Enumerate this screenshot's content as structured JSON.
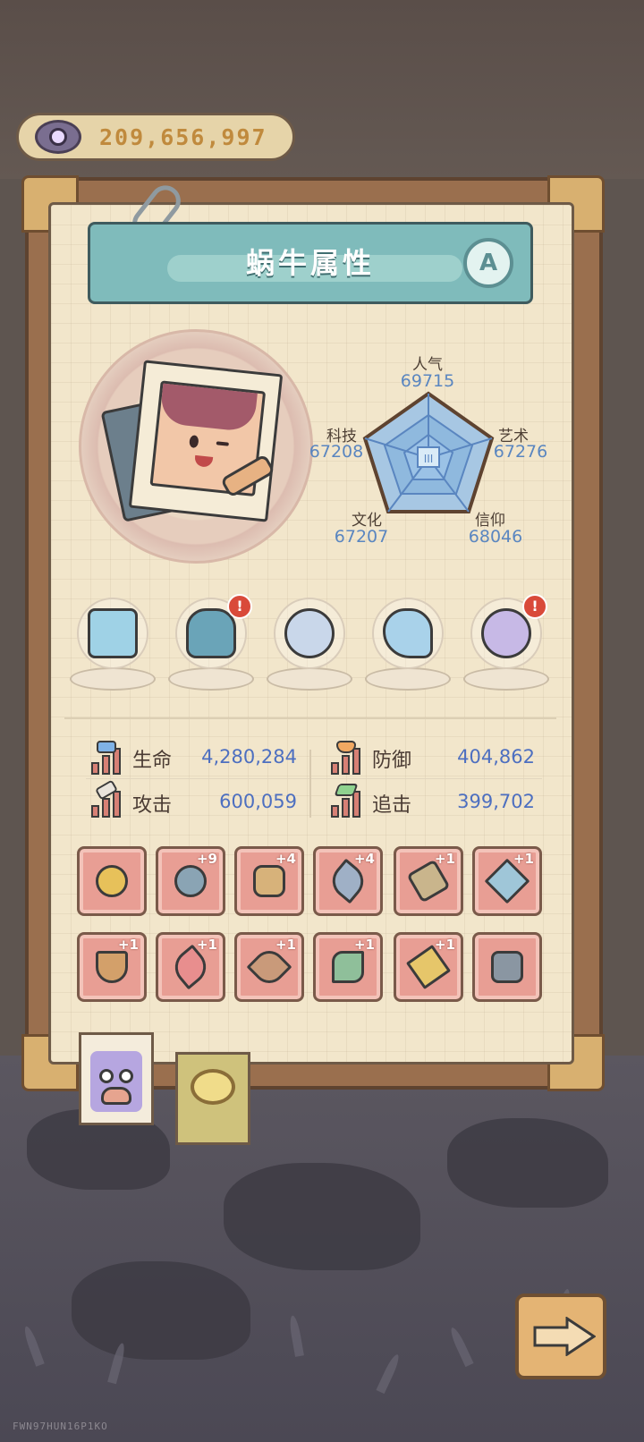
{
  "currency": {
    "icon": "eye-icon",
    "amount": "209,656,997"
  },
  "panel": {
    "title": "蜗牛属性",
    "grade": "A"
  },
  "radar": {
    "center_mark": "III",
    "axes": [
      {
        "label": "人气",
        "value": "69715"
      },
      {
        "label": "艺术",
        "value": "67276"
      },
      {
        "label": "信仰",
        "value": "68046"
      },
      {
        "label": "文化",
        "value": "67207"
      },
      {
        "label": "科技",
        "value": "67208"
      }
    ]
  },
  "treasures": [
    {
      "icon": "eye-tablet-icon",
      "alert": ""
    },
    {
      "icon": "fish-creature-icon",
      "alert": "!"
    },
    {
      "icon": "compass-icon",
      "alert": ""
    },
    {
      "icon": "tornado-icon",
      "alert": ""
    },
    {
      "icon": "gem-orb-icon",
      "alert": "!"
    }
  ],
  "stats": {
    "hp": {
      "label": "生命",
      "value": "4,280,284"
    },
    "defense": {
      "label": "防御",
      "value": "404,862"
    },
    "attack": {
      "label": "攻击",
      "value": "600,059"
    },
    "pursuit": {
      "label": "追击",
      "value": "399,702"
    }
  },
  "equipment": [
    {
      "icon": "golden-ring-icon",
      "plus": ""
    },
    {
      "icon": "bracelet-icon",
      "plus": "+9"
    },
    {
      "icon": "armor-icon",
      "plus": "+4"
    },
    {
      "icon": "dagger-icon",
      "plus": "+4"
    },
    {
      "icon": "bone-staff-icon",
      "plus": "+1"
    },
    {
      "icon": "sword-icon",
      "plus": "+1"
    },
    {
      "icon": "slingshot-icon",
      "plus": "+1"
    },
    {
      "icon": "scepter-icon",
      "plus": "+1"
    },
    {
      "icon": "wand-icon",
      "plus": "+1"
    },
    {
      "icon": "axe-icon",
      "plus": "+1"
    },
    {
      "icon": "trident-icon",
      "plus": "+1"
    },
    {
      "icon": "device-icon",
      "plus": ""
    }
  ],
  "tabs": [
    {
      "icon": "snail-face-icon"
    },
    {
      "icon": "shell-icon"
    }
  ],
  "watermark": "FWN97HUN16P1KO",
  "colors": {
    "stat_value": "#4d6fc0",
    "radar_value": "#5a86c0",
    "equip_bg": "#e89e94",
    "banner": "#7fbbbb"
  }
}
